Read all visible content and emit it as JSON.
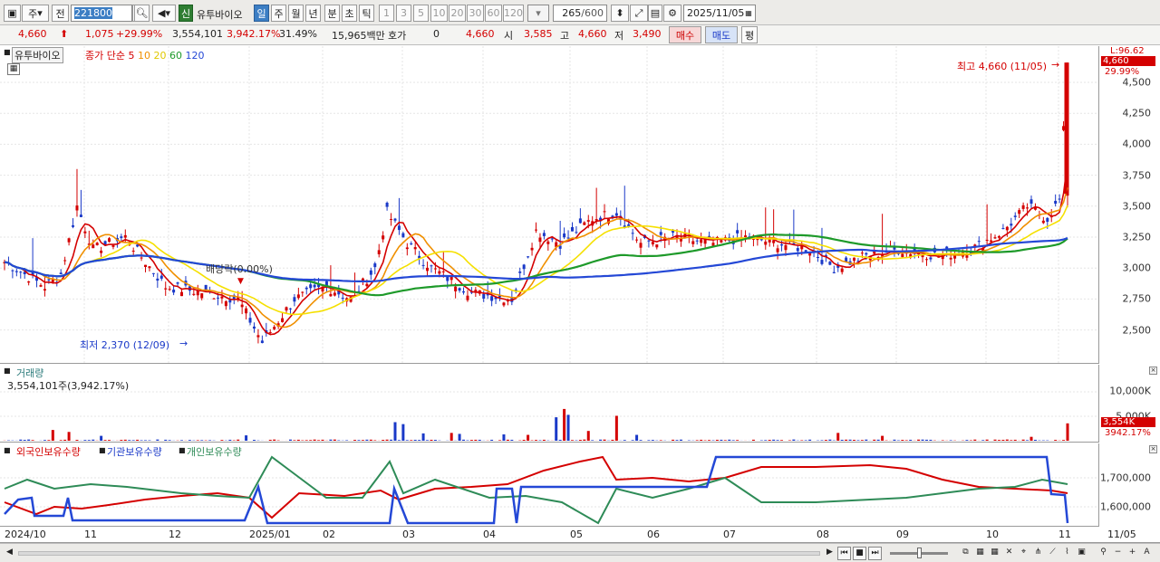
{
  "toolbar": {
    "period_select": "주",
    "prev_label": "전",
    "code": "221800",
    "market_badge": "신",
    "stock_name": "유투바이오",
    "intervals": [
      "일",
      "주",
      "월",
      "년",
      "분",
      "초",
      "틱"
    ],
    "numbers": [
      "1",
      "3",
      "5",
      "10",
      "20",
      "30",
      "60",
      "120"
    ],
    "count": "265",
    "count_max": "/600",
    "date": "2025/11/05"
  },
  "quote": {
    "price": "4,660",
    "change": "1,075",
    "change_pct": "+29.99%",
    "volume": "3,554,101",
    "volume_pct": "3,942.17%",
    "turnover_pct": "31.49%",
    "amount": "15,965백만",
    "hoga_label": "호가",
    "hoga_value": "0",
    "ask": "4,660",
    "open_label": "시",
    "open": "3,585",
    "high_label": "고",
    "high": "4,660",
    "low_label": "저",
    "low": "3,490",
    "buy_button": "매수",
    "sell_button": "매도",
    "extra_button": "평"
  },
  "price_panel": {
    "stock_label": "유투바이오",
    "ma_label": "종가 단순",
    "ma_periods": [
      "5",
      "10",
      "20",
      "60",
      "120"
    ],
    "ma_colors": [
      "#d40000",
      "#f09000",
      "#f5e000",
      "#1e9a2a",
      "#2448d6"
    ],
    "y_ticks": [
      "4,500",
      "4,250",
      "4,000",
      "3,750",
      "3,500",
      "3,250",
      "3,000",
      "2,750",
      "2,500"
    ],
    "axis_top_label": "L:96.62",
    "current_tag": "4,660",
    "current_pct": "29.99%",
    "high_annotation": "최고 4,660 (11/05)",
    "low_annotation": "최저 2,370 (12/09)",
    "dividend_annotation": "배당락(0.00%)"
  },
  "volume_panel": {
    "title": "거래량",
    "value": "3,554,101주(3,942.17%)",
    "y_ticks": [
      "10,000K",
      "5,000K"
    ],
    "current_tag": "3,554K",
    "current_pct": "3942.17%"
  },
  "holdings_panel": {
    "legend": [
      "외국인보유수량",
      "기관보유수량",
      "개인보유수량"
    ],
    "colors": [
      "#d40000",
      "#2448d6",
      "#2e8b57"
    ],
    "y_ticks": [
      "1,700,000",
      "1,600,000"
    ]
  },
  "x_axis": {
    "labels": [
      "2024/10",
      "11",
      "12",
      "2025/01",
      "02",
      "03",
      "04",
      "05",
      "06",
      "07",
      "08",
      "09",
      "10",
      "11",
      "11/05"
    ]
  },
  "chart_data": {
    "type": "candlestick",
    "title": "유투바이오",
    "x_range": [
      "2024/10",
      "2025/11/05"
    ],
    "ylim": [
      2300,
      4700
    ],
    "high": {
      "value": 4660,
      "date": "11/05"
    },
    "low": {
      "value": 2370,
      "date": "12/09"
    },
    "last": {
      "open": 3585,
      "high": 4660,
      "low": 3490,
      "close": 4660,
      "volume": 3554101
    },
    "moving_averages": [
      "5",
      "10",
      "20",
      "60",
      "120"
    ]
  }
}
